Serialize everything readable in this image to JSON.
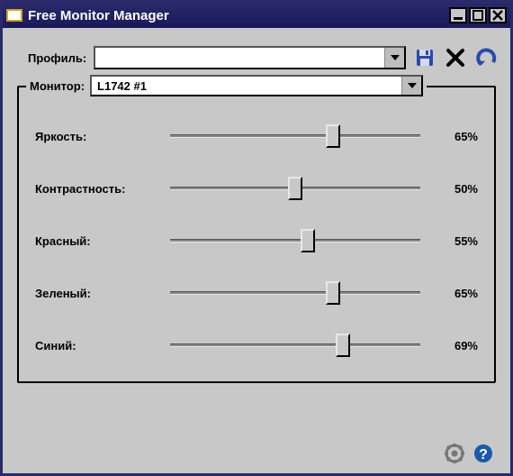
{
  "window": {
    "title": "Free Monitor Manager"
  },
  "profile": {
    "label": "Профиль:",
    "value": ""
  },
  "monitor": {
    "label": "Монитор:",
    "value": "L1742 #1"
  },
  "sliders": [
    {
      "label": "Яркость:",
      "value": 65,
      "display": "65%"
    },
    {
      "label": "Контрастность:",
      "value": 50,
      "display": "50%"
    },
    {
      "label": "Красный:",
      "value": 55,
      "display": "55%"
    },
    {
      "label": "Зеленый:",
      "value": 65,
      "display": "65%"
    },
    {
      "label": "Синий:",
      "value": 69,
      "display": "69%"
    }
  ],
  "icons": {
    "save": "save-icon",
    "delete": "delete-icon",
    "undo": "undo-icon",
    "settings": "gear-icon",
    "help": "help-icon"
  }
}
